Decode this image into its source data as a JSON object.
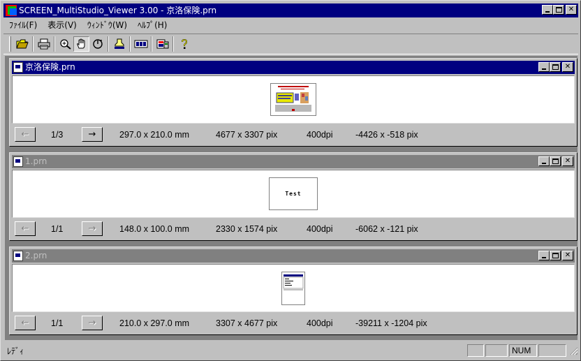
{
  "window": {
    "title": "SCREEN_MultiStudio_Viewer 3.00 - 京洛保険.prn"
  },
  "menu": [
    {
      "label": "ﾌｧｲﾙ(F)"
    },
    {
      "label": "表示(V)"
    },
    {
      "label": "ｳｨﾝﾄﾞｳ(W)"
    },
    {
      "label": "ﾍﾙﾌﾟ(H)"
    }
  ],
  "toolbar": {
    "buttons": [
      "open-folder-icon",
      "print-icon",
      "zoom-icon",
      "hand-pan-icon",
      "rotate-icon",
      "stamp-icon",
      "pages-icon",
      "settings-icon",
      "help-icon"
    ],
    "pressed": "hand-pan-icon"
  },
  "documents": [
    {
      "name": "京洛保険.prn",
      "active": true,
      "page": "1/3",
      "prev_enabled": false,
      "next_enabled": true,
      "size_mm": "297.0 x 210.0 mm",
      "size_pix": "4677 x 3307 pix",
      "dpi": "400dpi",
      "offset": "-4426 x -518 pix",
      "prev_label": "←",
      "next_label": "→"
    },
    {
      "name": "1.prn",
      "active": false,
      "page": "1/1",
      "prev_enabled": false,
      "next_enabled": false,
      "size_mm": "148.0 x 100.0 mm",
      "size_pix": "2330 x 1574 pix",
      "dpi": "400dpi",
      "offset": "-6062 x -121 pix",
      "thumb_text": "Test",
      "prev_label": "←",
      "next_label": "→"
    },
    {
      "name": "2.prn",
      "active": false,
      "page": "1/1",
      "prev_enabled": false,
      "next_enabled": false,
      "size_mm": "210.0 x 297.0 mm",
      "size_pix": "3307 x 4677 pix",
      "dpi": "400dpi",
      "offset": "-39211 x -1204 pix",
      "prev_label": "←",
      "next_label": "→"
    }
  ],
  "statusbar": {
    "ready": "ﾚﾃﾞｨ",
    "num": "NUM"
  }
}
